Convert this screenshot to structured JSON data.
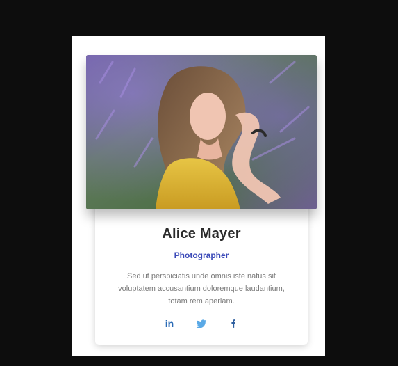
{
  "profile": {
    "name": "Alice Mayer",
    "role": "Photographer",
    "bio": "Sed ut perspiciatis unde omnis iste natus sit voluptatem accusantium doloremque laudantium, totam rem aperiam."
  },
  "social": [
    {
      "network": "linkedin",
      "glyph": "in",
      "color": "#2b6bb6"
    },
    {
      "network": "twitter",
      "icon": "twitter-bird-icon",
      "color": "#5aa9e6"
    },
    {
      "network": "facebook",
      "icon": "facebook-f-icon",
      "color": "#2f5f9f"
    }
  ],
  "colors": {
    "background": "#0d0d0d",
    "panel": "#ffffff",
    "name": "#2b2b2b",
    "role": "#3a49b8",
    "bio": "#7b7b7b"
  }
}
